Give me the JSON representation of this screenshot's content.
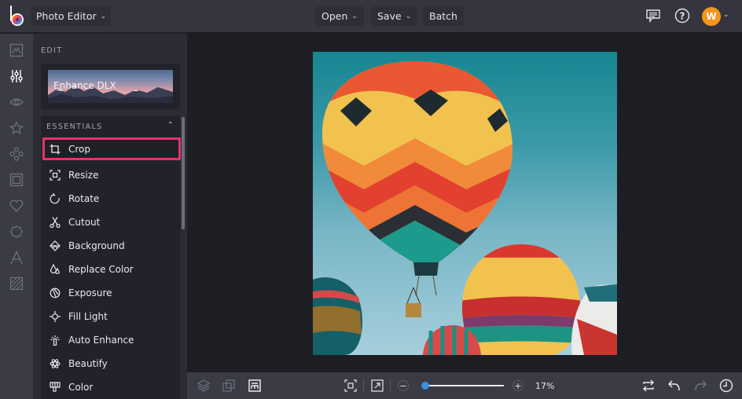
{
  "topbar": {
    "app_name": "Photo Editor",
    "menus": [
      {
        "label": "Open",
        "has_dropdown": true
      },
      {
        "label": "Save",
        "has_dropdown": true
      },
      {
        "label": "Batch",
        "has_dropdown": false
      }
    ],
    "right_icons": [
      "feedback-icon",
      "help-icon"
    ],
    "avatar_initial": "W",
    "avatar_color": "#f4951c"
  },
  "rail": {
    "items": [
      {
        "name": "image-icon",
        "active": false
      },
      {
        "name": "adjustments-icon",
        "active": true
      },
      {
        "name": "eye-icon",
        "active": false
      },
      {
        "name": "star-icon",
        "active": false
      },
      {
        "name": "shapes-icon",
        "active": false
      },
      {
        "name": "frame-icon",
        "active": false
      },
      {
        "name": "heart-icon",
        "active": false
      },
      {
        "name": "badge-icon",
        "active": false
      },
      {
        "name": "text-icon",
        "active": false
      },
      {
        "name": "texture-icon",
        "active": false
      }
    ]
  },
  "panel": {
    "title": "EDIT",
    "enhance_card": {
      "label": "Enhance DLX"
    },
    "essentials": {
      "header": "ESSENTIALS",
      "collapse_icon": "chevron-up-icon",
      "tools": [
        {
          "label": "Crop",
          "icon": "crop-icon",
          "selected": true
        },
        {
          "label": "Resize",
          "icon": "resize-icon",
          "selected": false
        },
        {
          "label": "Rotate",
          "icon": "rotate-icon",
          "selected": false
        },
        {
          "label": "Cutout",
          "icon": "scissors-icon",
          "selected": false
        },
        {
          "label": "Background",
          "icon": "background-icon",
          "selected": false
        },
        {
          "label": "Replace Color",
          "icon": "drops-icon",
          "selected": false
        },
        {
          "label": "Exposure",
          "icon": "exposure-icon",
          "selected": false
        },
        {
          "label": "Fill Light",
          "icon": "fill-light-icon",
          "selected": false
        },
        {
          "label": "Auto Enhance",
          "icon": "auto-enhance-icon",
          "selected": false
        },
        {
          "label": "Beautify",
          "icon": "beautify-icon",
          "selected": false
        },
        {
          "label": "Color",
          "icon": "color-icon",
          "selected": false
        }
      ]
    },
    "highlight_color": "#e5326a"
  },
  "canvas": {
    "image_description": "Hot air balloons against a blue sky"
  },
  "bottombar": {
    "left_icons": [
      "layers-icon",
      "overlap-icon",
      "layout-icon"
    ],
    "fit_icon": "fit-screen-icon",
    "actual_size_icon": "expand-icon",
    "zoom": {
      "value_label": "17%",
      "percent": 17,
      "slider_fraction": 0.02
    },
    "right_icons": [
      "compare-icon",
      "undo-icon",
      "redo-icon",
      "history-icon"
    ],
    "slider_color": "#3b8fe0"
  }
}
